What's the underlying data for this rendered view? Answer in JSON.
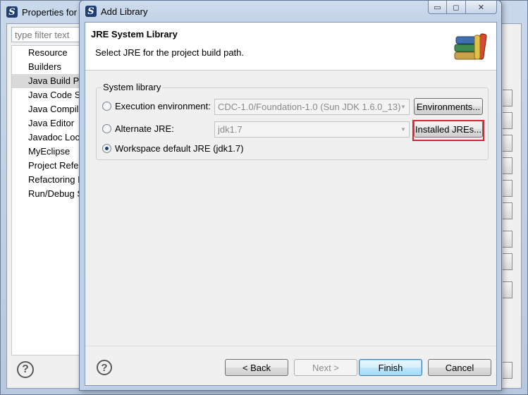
{
  "background_window": {
    "title": "Properties for",
    "filter_placeholder": "type filter text",
    "tree_items": [
      {
        "label": "Resource",
        "selected": false
      },
      {
        "label": "Builders",
        "selected": false
      },
      {
        "label": "Java Build Pa",
        "selected": true
      },
      {
        "label": "Java Code St",
        "selected": false
      },
      {
        "label": "Java Compile",
        "selected": false
      },
      {
        "label": "Java Editor",
        "selected": false
      },
      {
        "label": "Javadoc Loca",
        "selected": false
      },
      {
        "label": "MyEclipse",
        "selected": false
      },
      {
        "label": "Project Refer",
        "selected": false
      },
      {
        "label": "Refactoring I",
        "selected": false
      },
      {
        "label": "Run/Debug S",
        "selected": false
      }
    ],
    "help_glyph": "?"
  },
  "dialog": {
    "title": "Add Library",
    "window_buttons": {
      "minimize": "▭",
      "maximize": "◻",
      "close": "✕"
    },
    "header": {
      "title": "JRE System Library",
      "message": "Select JRE for the project build path."
    },
    "group": {
      "label": "System library",
      "options": [
        {
          "label": "Execution environment:",
          "checked": false
        },
        {
          "label": "Alternate JRE:",
          "checked": false
        },
        {
          "label": "Workspace default JRE (jdk1.7)",
          "checked": true
        }
      ],
      "exec_env_value": "CDC-1.0/Foundation-1.0 (Sun JDK 1.6.0_13)",
      "alternate_jre_value": "jdk1.7",
      "environments_button": "Environments...",
      "installed_jres_button": "Installed JREs..."
    },
    "footer": {
      "help_glyph": "?",
      "back": "< Back",
      "next": "Next >",
      "finish": "Finish",
      "cancel": "Cancel"
    }
  },
  "colors": {
    "highlight_box": "#d7262e",
    "title_bar": "#c1d2e7"
  }
}
